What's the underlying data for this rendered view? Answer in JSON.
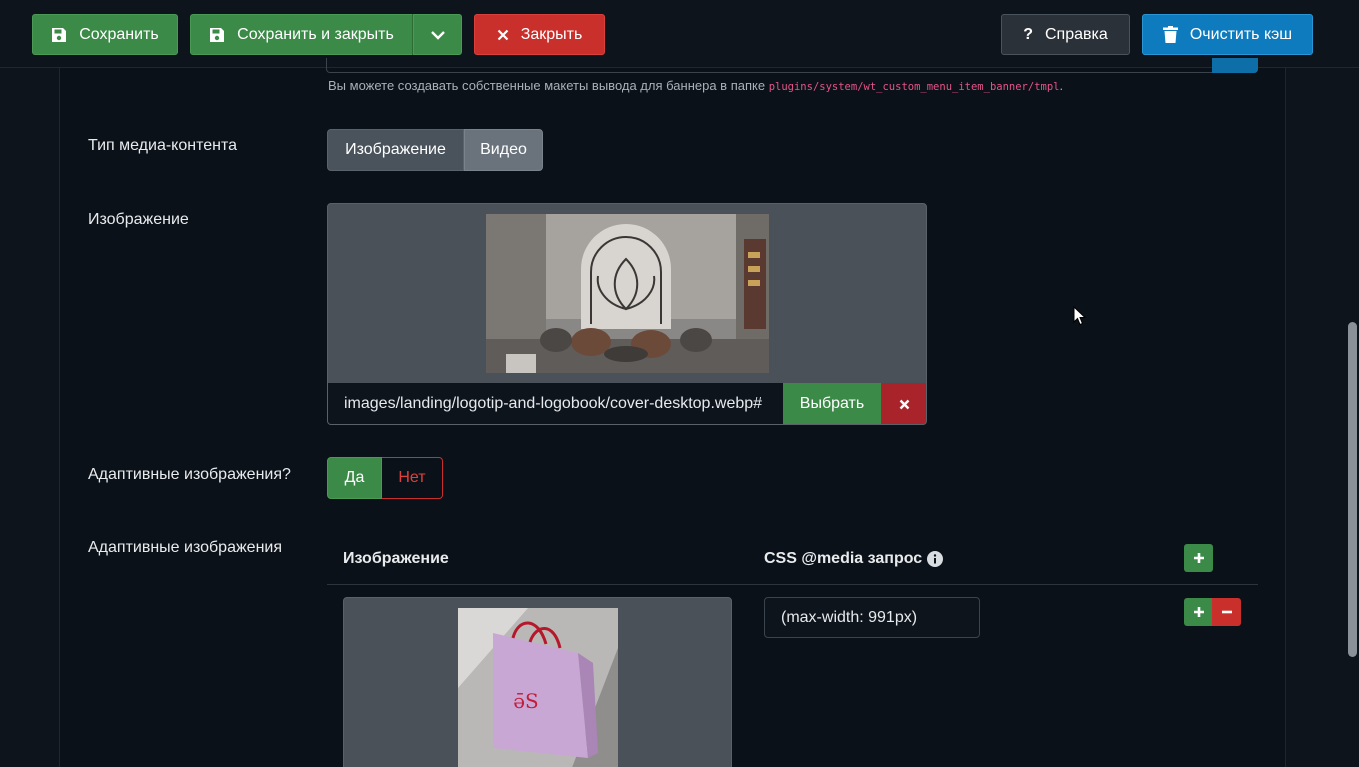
{
  "toolbar": {
    "save_label": "Сохранить",
    "save_close_label": "Сохранить и закрыть",
    "close_label": "Закрыть",
    "help_label": "Справка",
    "clear_cache_label": "Очистить кэш"
  },
  "layout_hint": {
    "text": "Вы можете создавать собственные макеты вывода для баннера в папке",
    "path": "plugins/system/wt_custom_menu_item_banner/tmpl",
    "suffix": "."
  },
  "media_type": {
    "label": "Тип медиа-контента",
    "options": [
      "Изображение",
      "Видео"
    ],
    "selected": "Изображение"
  },
  "image_field": {
    "label": "Изображение",
    "path": "images/landing/logotip-and-logobook/cover-desktop.webp#",
    "select_label": "Выбрать"
  },
  "adaptive_toggle": {
    "label": "Адаптивные изображения?",
    "yes": "Да",
    "no": "Нет",
    "selected": "Да"
  },
  "adaptive_table": {
    "label": "Адаптивные изображения",
    "col_image": "Изображение",
    "col_media": "CSS @media запрос",
    "rows": [
      {
        "media": "(max-width: 991px)"
      }
    ]
  },
  "colors": {
    "success": "#3b8a47",
    "danger": "#c9302c",
    "primary": "#0d7bbd",
    "background": "#0e141c"
  }
}
